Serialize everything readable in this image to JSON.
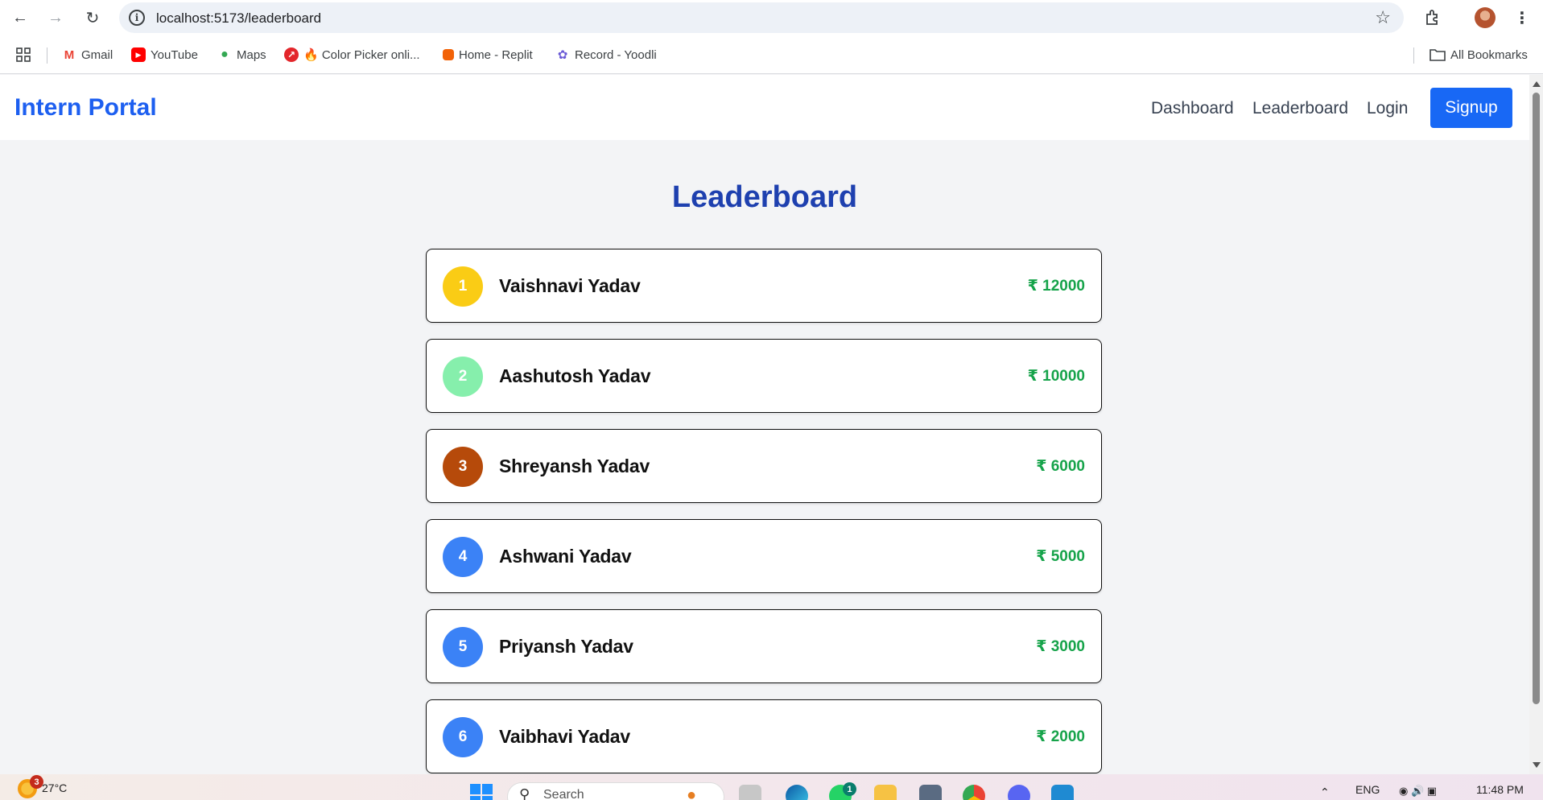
{
  "browser": {
    "url": "localhost:5173/leaderboard",
    "bookmarks": [
      {
        "label": "Gmail",
        "icon": "gmail-icon",
        "color": "#ea4335"
      },
      {
        "label": "YouTube",
        "icon": "youtube-icon",
        "color": "#ff0000"
      },
      {
        "label": "Maps",
        "icon": "maps-icon",
        "color": "#34a853"
      },
      {
        "label": "🔥 Color Picker onli...",
        "icon": "color-picker-icon",
        "color": "#e3262b"
      },
      {
        "label": "Home - Replit",
        "icon": "replit-icon",
        "color": "#f26207"
      },
      {
        "label": "Record - Yoodli",
        "icon": "yoodli-icon",
        "color": "#6b5bd6"
      }
    ],
    "all_bookmarks": "All Bookmarks"
  },
  "app": {
    "brand": "Intern Portal",
    "nav": {
      "dashboard": "Dashboard",
      "leaderboard": "Leaderboard",
      "login": "Login",
      "signup": "Signup"
    },
    "title": "Leaderboard",
    "entries": [
      {
        "rank": "1",
        "name": "Vaishnavi Yadav",
        "amount": "₹ 12000",
        "color": "#facc15"
      },
      {
        "rank": "2",
        "name": "Aashutosh Yadav",
        "amount": "₹ 10000",
        "color": "#86efac"
      },
      {
        "rank": "3",
        "name": "Shreyansh Yadav",
        "amount": "₹ 6000",
        "color": "#b64a0a"
      },
      {
        "rank": "4",
        "name": "Ashwani Yadav",
        "amount": "₹ 5000",
        "color": "#3b82f6"
      },
      {
        "rank": "5",
        "name": "Priyansh Yadav",
        "amount": "₹ 3000",
        "color": "#3b82f6"
      },
      {
        "rank": "6",
        "name": "Vaibhavi Yadav",
        "amount": "₹ 2000",
        "color": "#3b82f6"
      }
    ]
  },
  "taskbar": {
    "weather_badge": "3",
    "temperature": "27°C",
    "search_placeholder": "Search",
    "whatsapp_badge": "1",
    "language": "ENG",
    "time": "11:48 PM"
  }
}
